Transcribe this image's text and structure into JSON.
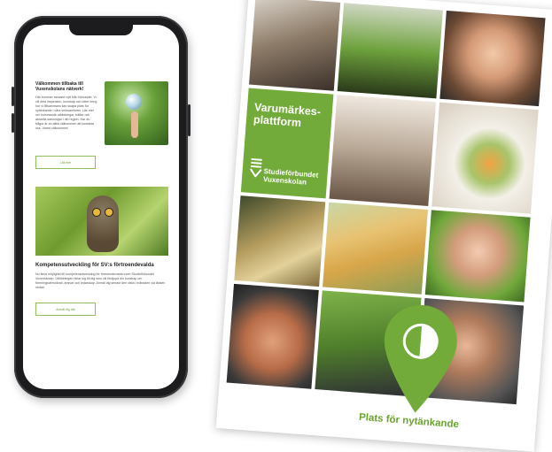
{
  "phone_email": {
    "section1_heading": "Välkommen tillbaka till Vuxenskolans nätverk!",
    "section1_body": "Här kommer senaste nytt från förbundet. Vi vill dela inspiration, kunskap och idéer kring hur vi tillsammans kan skapa plats för nytänkande i våra verksamheter. Läs mer om kommande utbildningar, träffar och aktuella satsningar i din region. Har du frågor är du alltid välkommen att kontakta oss. Varmt välkommen!",
    "section1_button": "Läs mer",
    "section2_heading": "Kompetensutveckling för SV:s förtroendevalda",
    "section2_body": "Nu finns möjlighet till kompetensutveckling för förtroendevalda inom Studieförbundet Vuxenskolan. Utbildningen riktar sig till dig som vill fördjupa din kunskap om föreningsdemokrati, ansvar och ledarskap. Anmäl dig senast den sista i månaden via länken nedan.",
    "section2_button": "Anmäl dig här"
  },
  "brochure": {
    "title": "Varumärkes-plattform",
    "logo_text_line1": "Studieförbundet",
    "logo_text_line2": "Vuxenskolan",
    "tagline": "Plats för nytänkande",
    "brand_color": "#72ab3a"
  }
}
